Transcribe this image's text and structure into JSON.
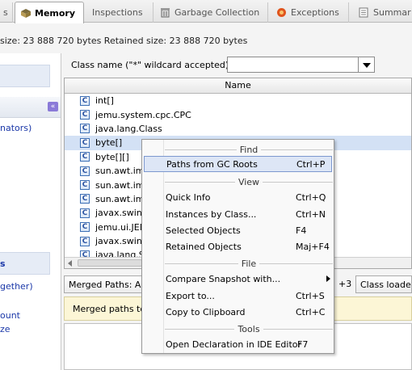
{
  "tabs": [
    {
      "label": "s",
      "icon": "none"
    },
    {
      "label": "Memory",
      "icon": "memory-icon"
    },
    {
      "label": "Inspections",
      "icon": "none"
    },
    {
      "label": "Garbage Collection",
      "icon": "trash-icon"
    },
    {
      "label": "Exceptions",
      "icon": "exceptions-icon"
    },
    {
      "label": "Summar",
      "icon": "summary-icon"
    }
  ],
  "sizes_text": "size: 23 888 720 bytes  Retained size: 23 888 720 bytes",
  "sidebar": {
    "link1": "nators)",
    "selected": "s",
    "link2": "gether)",
    "link3": "ount",
    "link4": "ze"
  },
  "filter": {
    "label": "Class name (\"*\" wildcard accepted):",
    "value": ""
  },
  "table": {
    "header": "Name",
    "rows": [
      {
        "name": "int[]"
      },
      {
        "name": "jemu.system.cpc.CPC"
      },
      {
        "name": "java.lang.Class"
      },
      {
        "name": "byte[]"
      },
      {
        "name": "byte[][]"
      },
      {
        "name": "sun.awt.im"
      },
      {
        "name": "sun.awt.im"
      },
      {
        "name": "sun.awt.im"
      },
      {
        "name": "javax.swing"
      },
      {
        "name": "jemu.ui.JEM"
      },
      {
        "name": "javax.swing"
      },
      {
        "name": "java.lang.St"
      }
    ],
    "selected_index": 3,
    "icon_letter": "C"
  },
  "bottom_tabs": {
    "merged_paths": "Merged Paths: Alt",
    "ctrl3": "+3",
    "class_loaders": "Class loaders"
  },
  "merged_message": "Merged paths to",
  "context_menu": {
    "sections": {
      "find": "Find",
      "view": "View",
      "file": "File",
      "tools": "Tools"
    },
    "items": {
      "paths_gc": {
        "label": "Paths from GC Roots",
        "shortcut": "Ctrl+P"
      },
      "quick_info": {
        "label": "Quick Info",
        "shortcut": "Ctrl+Q"
      },
      "instances": {
        "label": "Instances by Class...",
        "shortcut": "Ctrl+N"
      },
      "selected_objects": {
        "label": "Selected Objects",
        "shortcut": "F4"
      },
      "retained_objects": {
        "label": "Retained Objects",
        "shortcut": "Maj+F4"
      },
      "compare_snapshot": {
        "label": "Compare Snapshot with...",
        "shortcut": ""
      },
      "export_to": {
        "label": "Export to...",
        "shortcut": "Ctrl+S"
      },
      "copy_clipboard": {
        "label": "Copy to Clipboard",
        "shortcut": "Ctrl+C"
      },
      "open_declaration": {
        "label": "Open Declaration in IDE Editor",
        "shortcut": "F7"
      }
    }
  },
  "colors": {
    "selection": "#d3e1f5",
    "menu_highlight": "#dde6f6",
    "link": "#1a37a8",
    "message_bg": "#fcf6d6"
  }
}
